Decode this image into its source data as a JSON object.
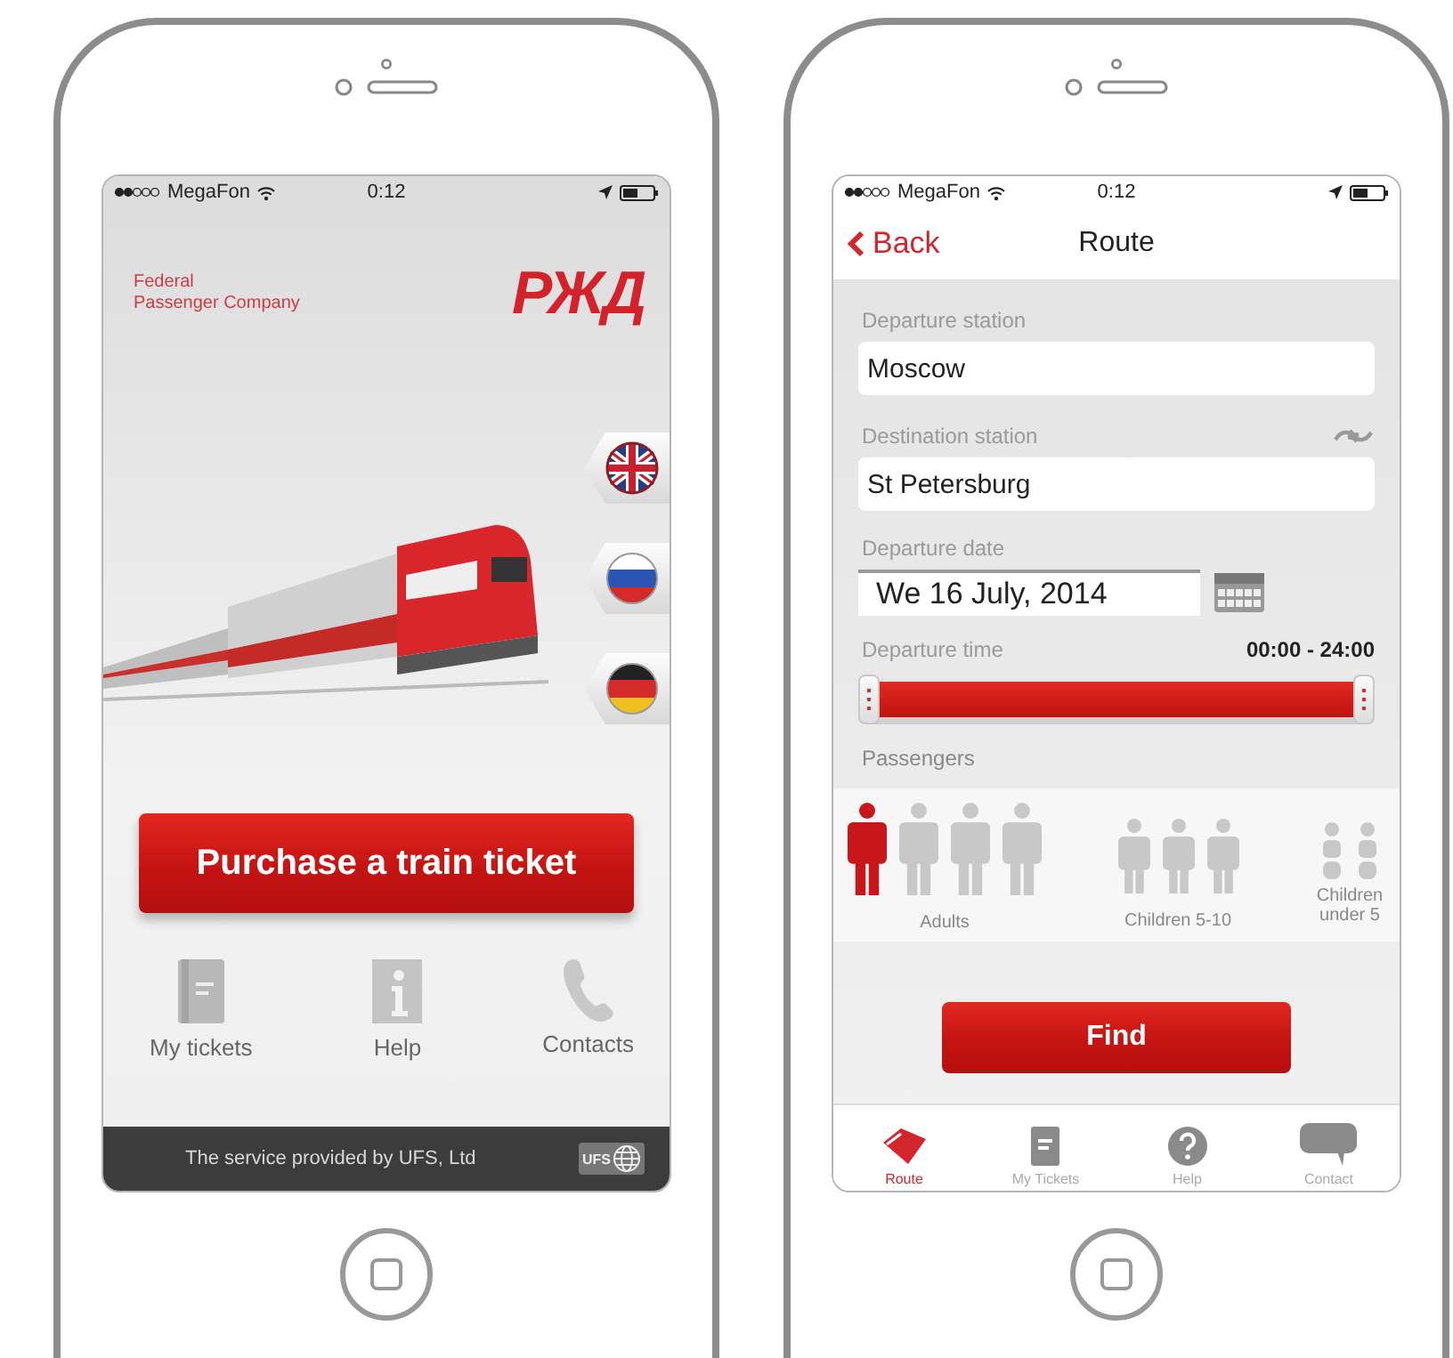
{
  "home_screen": {
    "status_bar": {
      "carrier": "MegaFon",
      "time": "0:12"
    },
    "company_name": "Federal\nPassenger Company",
    "logo": "РЖД",
    "purchase_button": "Purchase a train ticket",
    "nav_items": [
      {
        "label": "My tickets"
      },
      {
        "label": "Help"
      },
      {
        "label": "Contacts"
      }
    ],
    "footer": {
      "text": "The service provided by UFS, Ltd",
      "logo_text": "UFS"
    }
  },
  "route_screen": {
    "status_bar": {
      "carrier": "MegaFon",
      "time": "0:12"
    },
    "back_button": "Back",
    "title": "Route",
    "departure": {
      "label": "Departure station",
      "value": "Moscow"
    },
    "destination": {
      "label": "Destination station",
      "value": "St Petersburg"
    },
    "date": {
      "label": "Departure date",
      "value": "We 16 July, 2014"
    },
    "time": {
      "label": "Departure time",
      "range": "00:00 - 24:00",
      "level": 1
    },
    "passengers": {
      "label": "Passengers",
      "groups": [
        {
          "label": "Adults",
          "kind": "adult",
          "figures": [
            {
              "selected": true
            },
            {
              "selected": false
            },
            {
              "selected": false
            },
            {
              "selected": false
            }
          ]
        },
        {
          "label": "Children 5-10",
          "kind": "child",
          "figures": [
            {
              "selected": false
            },
            {
              "selected": false
            },
            {
              "selected": false
            }
          ]
        },
        {
          "label": "Children under 5",
          "kind": "infant",
          "figures": [
            {
              "selected": false
            },
            {
              "selected": false
            }
          ]
        }
      ]
    },
    "find_button": "Find",
    "tabs": [
      {
        "label": "Route",
        "selected": true
      },
      {
        "label": "My Tickets",
        "selected": false
      },
      {
        "label": "Help",
        "selected": false
      },
      {
        "label": "Contact",
        "selected": false
      }
    ]
  }
}
